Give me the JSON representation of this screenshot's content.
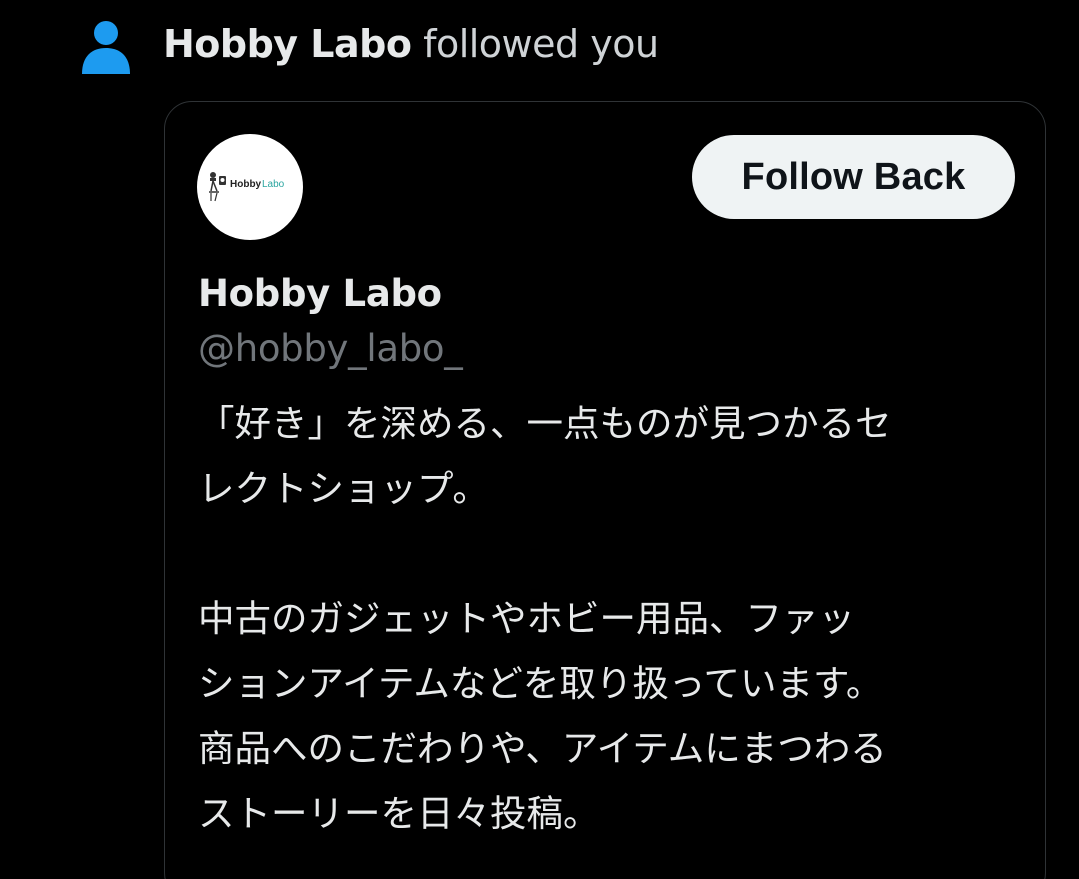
{
  "notification": {
    "actor": "Hobby Labo",
    "action": " followed you",
    "icon": "person-icon",
    "icon_color": "#1d9bf0"
  },
  "profile_card": {
    "avatar": {
      "logo_text_dark": "Hobby",
      "logo_text_accent": "Labo",
      "accent_color": "#2aa5a0"
    },
    "follow_back_label": "Follow Back",
    "display_name": "Hobby Labo",
    "handle": "@hobby_labo_",
    "bio_lines": [
      "「好き」を深める、一点ものが見つかるセ",
      "レクトショップ。",
      "",
      "中古のガジェットやホビー用品、ファッ",
      "ションアイテムなどを取り扱っています。",
      "商品へのこだわりや、アイテムにまつわる",
      "ストーリーを日々投稿。"
    ]
  },
  "colors": {
    "background": "#000000",
    "text_primary": "#e7e9ea",
    "text_secondary": "#71767b",
    "button_bg": "#eff3f4",
    "button_text": "#0f1419",
    "card_border": "#2f3336"
  }
}
